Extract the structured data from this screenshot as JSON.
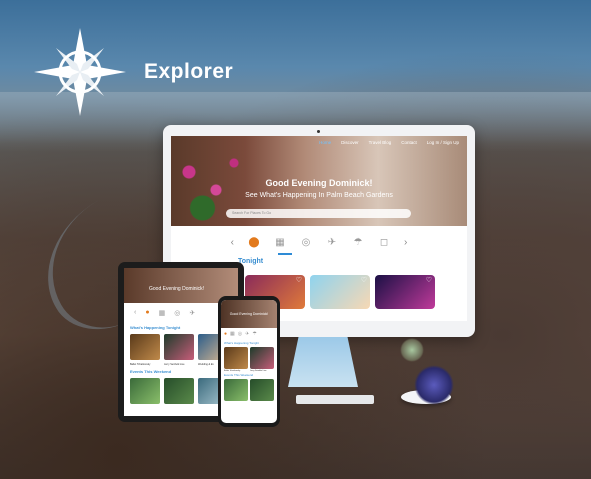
{
  "brand": {
    "title": "Explorer",
    "logo_icon": "compass-icon"
  },
  "desktop": {
    "nav": [
      "Home",
      "Discover",
      "Travel Blog",
      "Contact",
      "Log In / Sign Up"
    ],
    "greeting": "Good Evening Dominick!",
    "subtitle": "See What's Happening In Palm Beach Gardens",
    "search_placeholder": "Search For Places To Go",
    "categories": [
      "location-pin-icon",
      "calendar-icon",
      "dining-icon",
      "plane-icon",
      "weather-icon",
      "shopping-bag-icon"
    ],
    "section_title": "Tonight"
  },
  "tablet": {
    "greeting": "Good Evening Dominick!",
    "section_title": "What's Happening Tonight",
    "section2_title": "Events This Weekend",
    "captions": [
      "Ballet Tchaikovsky",
      "Jerry Seinfeld Live",
      "Wedding & Ev"
    ]
  },
  "phone": {
    "greeting": "Good Evening Dominick!",
    "section_title": "What's Happening Tonight",
    "section2_title": "Events This Weekend",
    "captions": [
      "Ballet Tchaikovsky",
      "Jerry Seinfeld Live"
    ]
  },
  "colors": {
    "accent": "#2e8bd6",
    "pin": "#e27a1d"
  }
}
